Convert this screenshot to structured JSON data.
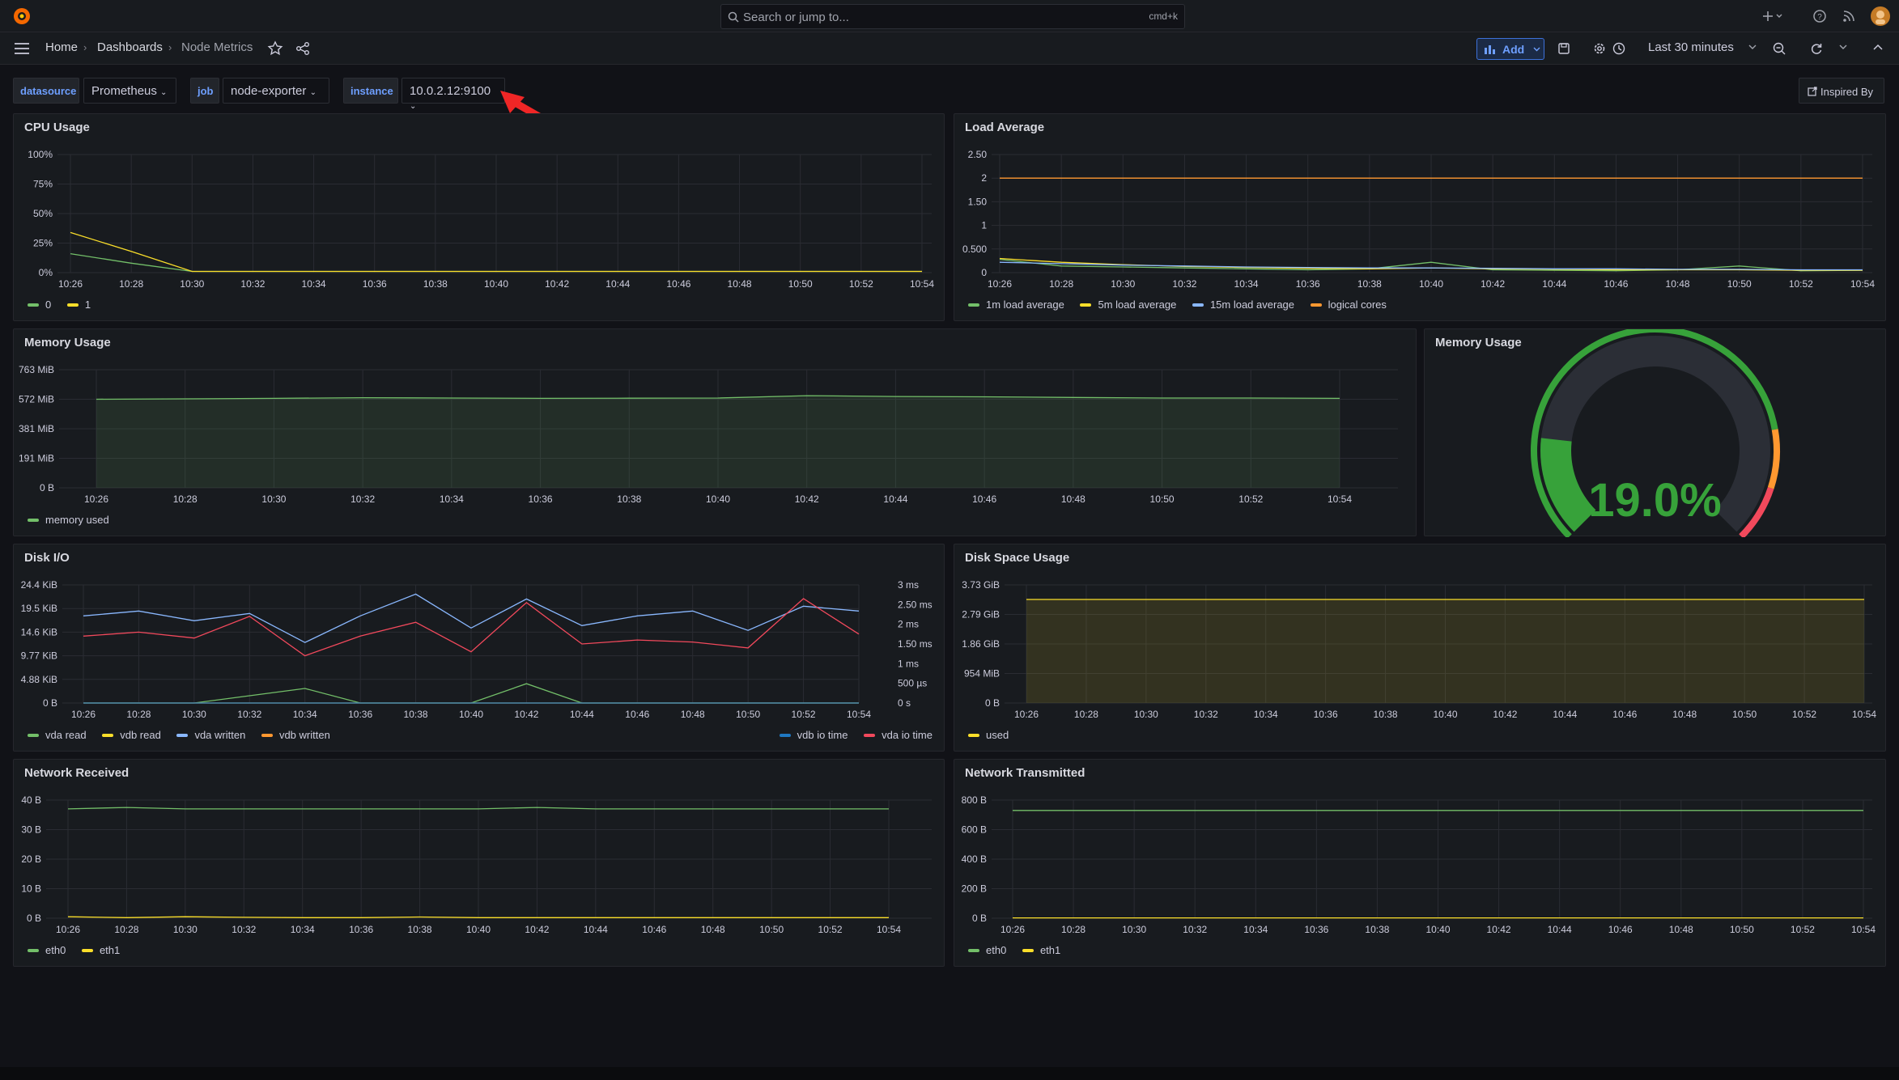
{
  "topbar": {
    "search_placeholder": "Search or jump to...",
    "search_shortcut": "cmd+k"
  },
  "breadcrumb": {
    "home": "Home",
    "dashboards": "Dashboards",
    "current": "Node Metrics"
  },
  "toolbar": {
    "add_label": "Add",
    "time_range": "Last 30 minutes"
  },
  "variables": {
    "datasource_label": "datasource",
    "datasource_value": "Prometheus",
    "job_label": "job",
    "job_value": "node-exporter",
    "instance_label": "instance",
    "instance_value": "10.0.2.12:9100",
    "inspired_by": "Inspired By"
  },
  "colors": {
    "green": "#73bf69",
    "yellow": "#fade2a",
    "blue": "#8ab8ff",
    "orange": "#ff9830",
    "red": "#f2495c",
    "darkblue": "#1f78c1",
    "accent": "#3d71d9"
  },
  "panels": {
    "cpu": {
      "title": "CPU Usage",
      "legend": [
        "0",
        "1"
      ]
    },
    "load": {
      "title": "Load Average",
      "legend": [
        "1m load average",
        "5m load average",
        "15m load average",
        "logical cores"
      ]
    },
    "mem": {
      "title": "Memory Usage",
      "legend": [
        "memory used"
      ]
    },
    "gauge": {
      "title": "Memory Usage",
      "value": "19.0%"
    },
    "disk": {
      "title": "Disk I/O",
      "legend_left": [
        "vda read",
        "vdb read",
        "vda written",
        "vdb written"
      ],
      "legend_right": [
        "vdb io time",
        "vda io time"
      ]
    },
    "space": {
      "title": "Disk Space Usage",
      "legend": [
        "used"
      ]
    },
    "netrx": {
      "title": "Network Received",
      "legend": [
        "eth0",
        "eth1"
      ]
    },
    "nettx": {
      "title": "Network Transmitted",
      "legend": [
        "eth0",
        "eth1"
      ]
    }
  },
  "chart_data": [
    {
      "id": "cpu",
      "type": "line",
      "title": "CPU Usage",
      "x": [
        "10:26",
        "10:28",
        "10:30",
        "10:32",
        "10:34",
        "10:36",
        "10:38",
        "10:40",
        "10:42",
        "10:44",
        "10:46",
        "10:48",
        "10:50",
        "10:52",
        "10:54"
      ],
      "yticks": [
        "0%",
        "25%",
        "50%",
        "75%",
        "100%"
      ],
      "ylim": [
        0,
        100
      ],
      "series": [
        {
          "name": "0",
          "color": "#73bf69",
          "values": [
            16,
            8,
            1,
            1,
            1,
            1,
            1,
            1,
            1,
            1,
            1,
            1,
            1,
            1,
            1
          ]
        },
        {
          "name": "1",
          "color": "#fade2a",
          "values": [
            34,
            18,
            1,
            1,
            1,
            1,
            1,
            1,
            1,
            1,
            1,
            1,
            1,
            1,
            1
          ]
        }
      ]
    },
    {
      "id": "load",
      "type": "line",
      "title": "Load Average",
      "x": [
        "10:26",
        "10:28",
        "10:30",
        "10:32",
        "10:34",
        "10:36",
        "10:38",
        "10:40",
        "10:42",
        "10:44",
        "10:46",
        "10:48",
        "10:50",
        "10:52",
        "10:54"
      ],
      "yticks": [
        "0",
        "0.500",
        "1",
        "1.50",
        "2",
        "2.50"
      ],
      "ylim": [
        0,
        2.5
      ],
      "series": [
        {
          "name": "1m load average",
          "color": "#73bf69",
          "values": [
            0.28,
            0.14,
            0.12,
            0.1,
            0.08,
            0.06,
            0.08,
            0.22,
            0.06,
            0.05,
            0.04,
            0.06,
            0.14,
            0.04,
            0.05
          ]
        },
        {
          "name": "5m load average",
          "color": "#fade2a",
          "values": [
            0.3,
            0.22,
            0.17,
            0.13,
            0.11,
            0.09,
            0.08,
            0.1,
            0.08,
            0.07,
            0.06,
            0.06,
            0.06,
            0.05,
            0.05
          ]
        },
        {
          "name": "15m load average",
          "color": "#8ab8ff",
          "values": [
            0.22,
            0.19,
            0.16,
            0.14,
            0.12,
            0.11,
            0.1,
            0.1,
            0.09,
            0.08,
            0.08,
            0.07,
            0.07,
            0.06,
            0.06
          ]
        },
        {
          "name": "logical cores",
          "color": "#ff9830",
          "values": [
            2,
            2,
            2,
            2,
            2,
            2,
            2,
            2,
            2,
            2,
            2,
            2,
            2,
            2,
            2
          ]
        }
      ]
    },
    {
      "id": "mem",
      "type": "area",
      "title": "Memory Usage",
      "x": [
        "10:26",
        "10:28",
        "10:30",
        "10:32",
        "10:34",
        "10:36",
        "10:38",
        "10:40",
        "10:42",
        "10:44",
        "10:46",
        "10:48",
        "10:50",
        "10:52",
        "10:54"
      ],
      "yticks": [
        "0 B",
        "191 MiB",
        "381 MiB",
        "572 MiB",
        "763 MiB"
      ],
      "ylim": [
        0,
        763
      ],
      "series": [
        {
          "name": "memory used",
          "color": "#73bf69",
          "values": [
            572,
            575,
            578,
            582,
            580,
            578,
            579,
            580,
            595,
            590,
            588,
            584,
            580,
            580,
            578
          ]
        }
      ]
    },
    {
      "id": "gauge",
      "type": "gauge",
      "title": "Memory Usage",
      "value": 19.0
    },
    {
      "id": "disk",
      "type": "line",
      "title": "Disk I/O",
      "x": [
        "10:26",
        "10:28",
        "10:30",
        "10:32",
        "10:34",
        "10:36",
        "10:38",
        "10:40",
        "10:42",
        "10:44",
        "10:46",
        "10:48",
        "10:50",
        "10:52",
        "10:54"
      ],
      "yticks": [
        "0 B",
        "4.88 KiB",
        "9.77 KiB",
        "14.6 KiB",
        "19.5 KiB",
        "24.4 KiB"
      ],
      "ylim": [
        0,
        24.4
      ],
      "yticks_right": [
        "0 s",
        "500 µs",
        "1 ms",
        "1.50 ms",
        "2 ms",
        "2.50 ms",
        "3 ms"
      ],
      "series": [
        {
          "name": "vda read",
          "color": "#73bf69",
          "values": [
            0,
            0,
            0,
            1.5,
            3,
            0,
            0,
            0,
            4,
            0,
            0,
            0,
            0,
            0,
            0
          ]
        },
        {
          "name": "vdb read",
          "color": "#fade2a",
          "values": [
            0,
            0,
            0,
            0,
            0,
            0,
            0,
            0,
            0,
            0,
            0,
            0,
            0,
            0,
            0
          ]
        },
        {
          "name": "vda written",
          "color": "#8ab8ff",
          "values": [
            18,
            19,
            17,
            18.5,
            12.5,
            18,
            22.5,
            15.5,
            21.5,
            16,
            18,
            19,
            15,
            20,
            19
          ]
        },
        {
          "name": "vdb written",
          "color": "#ff9830",
          "values": [
            0,
            0,
            0,
            0,
            0,
            0,
            0,
            0,
            0,
            0,
            0,
            0,
            0,
            0,
            0
          ]
        },
        {
          "name": "vdb io time",
          "color": "#1f78c1",
          "values": [
            0,
            0,
            0,
            0,
            0,
            0,
            0,
            0,
            0,
            0,
            0,
            0,
            0,
            0,
            0
          ]
        },
        {
          "name": "vda io time",
          "color": "#f2495c",
          "values": [
            1.7,
            1.8,
            1.65,
            2.2,
            1.2,
            1.7,
            2.05,
            1.3,
            2.55,
            1.5,
            1.6,
            1.55,
            1.4,
            2.65,
            1.75
          ]
        }
      ]
    },
    {
      "id": "space",
      "type": "area",
      "title": "Disk Space Usage",
      "x": [
        "10:26",
        "10:28",
        "10:30",
        "10:32",
        "10:34",
        "10:36",
        "10:38",
        "10:40",
        "10:42",
        "10:44",
        "10:46",
        "10:48",
        "10:50",
        "10:52",
        "10:54"
      ],
      "yticks": [
        "0 B",
        "954 MiB",
        "1.86 GiB",
        "2.79 GiB",
        "3.73 GiB"
      ],
      "ylim": [
        0,
        3.73
      ],
      "series": [
        {
          "name": "used",
          "color": "#fade2a",
          "values": [
            3.27,
            3.27,
            3.27,
            3.27,
            3.27,
            3.27,
            3.27,
            3.27,
            3.27,
            3.27,
            3.27,
            3.27,
            3.27,
            3.27,
            3.27
          ]
        }
      ]
    },
    {
      "id": "netrx",
      "type": "line",
      "title": "Network Received",
      "x": [
        "10:26",
        "10:28",
        "10:30",
        "10:32",
        "10:34",
        "10:36",
        "10:38",
        "10:40",
        "10:42",
        "10:44",
        "10:46",
        "10:48",
        "10:50",
        "10:52",
        "10:54"
      ],
      "yticks": [
        "0 B",
        "10 B",
        "20 B",
        "30 B",
        "40 B"
      ],
      "ylim": [
        0,
        40
      ],
      "series": [
        {
          "name": "eth0",
          "color": "#73bf69",
          "values": [
            37,
            37.5,
            37,
            37,
            37,
            37,
            37,
            37,
            37.5,
            37,
            37,
            37,
            37,
            37,
            37
          ]
        },
        {
          "name": "eth1",
          "color": "#fade2a",
          "values": [
            0.5,
            0.2,
            0.5,
            0.3,
            0.2,
            0.2,
            0.4,
            0.2,
            0.2,
            0.2,
            0.2,
            0.2,
            0.2,
            0.2,
            0.2
          ]
        }
      ]
    },
    {
      "id": "nettx",
      "type": "line",
      "title": "Network Transmitted",
      "x": [
        "10:26",
        "10:28",
        "10:30",
        "10:32",
        "10:34",
        "10:36",
        "10:38",
        "10:40",
        "10:42",
        "10:44",
        "10:46",
        "10:48",
        "10:50",
        "10:52",
        "10:54"
      ],
      "yticks": [
        "0 B",
        "200 B",
        "400 B",
        "600 B",
        "800 B"
      ],
      "ylim": [
        0,
        800
      ],
      "series": [
        {
          "name": "eth0",
          "color": "#73bf69",
          "values": [
            730,
            730,
            730,
            730,
            730,
            730,
            730,
            730,
            730,
            730,
            730,
            730,
            730,
            730,
            730
          ]
        },
        {
          "name": "eth1",
          "color": "#fade2a",
          "values": [
            2,
            2,
            2,
            2,
            2,
            2,
            2,
            2,
            2,
            2,
            2,
            2,
            2,
            2,
            2
          ]
        }
      ]
    }
  ]
}
